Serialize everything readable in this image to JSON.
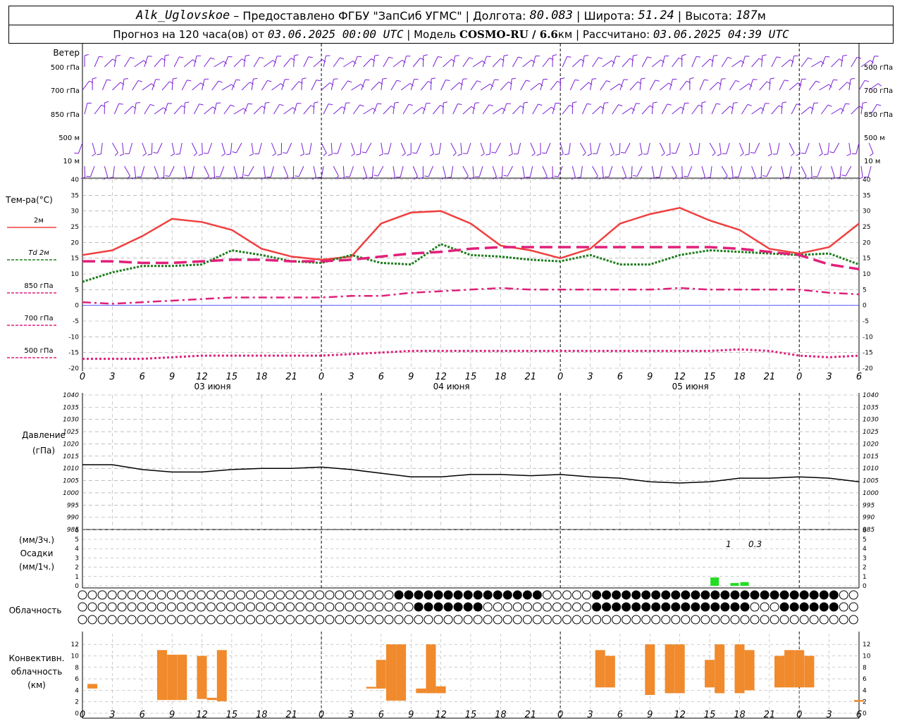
{
  "header": {
    "station": "Alk_Uglovskoe",
    "dash": " – ",
    "provider": "Предоставлено ФГБУ \"ЗапСиб УГМС\"",
    "sep": " | ",
    "lon_label": "Долгота: ",
    "lon_value": "80.083",
    "lat_label": "Широта: ",
    "lat_value": "51.24",
    "alt_label": "Высота: ",
    "alt_value": "187",
    "alt_unit": "м",
    "forecast_prefix": "Прогноз на 120 часа(ов) от ",
    "forecast_time": "03.06.2025 00:00 UTC",
    "model_label": "Модель ",
    "model_name": "COSMO-RU / 6.6",
    "model_unit": "км",
    "calc_label": "Рассчитано: ",
    "calc_time": "03.06.2025 04:39 UTC"
  },
  "colors": {
    "wind": "#7a1fd6",
    "t2m": "#f04040",
    "td2m": "#1e7d1e",
    "t850": "#e0207a",
    "t700": "#e0207a",
    "t500": "#e0207a",
    "zero_line": "#4040ff",
    "pressure": "#000000",
    "precip": "#22dd22",
    "convective": "#f08a2c",
    "grid": "#999999"
  },
  "wind_panel": {
    "title": "Ветер",
    "levels": [
      "500 гПа",
      "700 гПа",
      "850 гПа",
      "500 м",
      "10 м"
    ]
  },
  "temp_legend": {
    "title": "Тем-ра(°С)",
    "items": [
      "2м",
      "Td 2м",
      "850 гПа",
      "700 гПа",
      "500 гПа"
    ]
  },
  "pressure_label": [
    "Давление",
    "(гПа)"
  ],
  "precip_label": [
    "(мм/3ч.)",
    "Осадки",
    "(мм/1ч.)"
  ],
  "cloud_label": "Облачность",
  "conv_label": [
    "Конвективн.",
    "облачность",
    "(км)"
  ],
  "time_axis": {
    "tick_labels": [
      "0",
      "3",
      "6",
      "9",
      "12",
      "15",
      "18",
      "21",
      "0",
      "3",
      "6",
      "9",
      "12",
      "15",
      "18",
      "21",
      "0",
      "3",
      "6",
      "9",
      "12",
      "15",
      "18",
      "21",
      "0",
      "3",
      "6"
    ],
    "day_labels": [
      "03 июня",
      "04 июня",
      "05 июня"
    ]
  },
  "chart_data": [
    {
      "type": "line",
      "title": "Тем-ра(°С)",
      "xlabel": "UTC",
      "ylim": [
        -20,
        40
      ],
      "yticks": [
        40,
        35,
        30,
        25,
        20,
        15,
        10,
        5,
        0,
        -5,
        -10,
        -15,
        -20
      ],
      "x": [
        0,
        3,
        6,
        9,
        12,
        15,
        18,
        21,
        24,
        27,
        30,
        33,
        36,
        39,
        42,
        45,
        48,
        51,
        54,
        57,
        60,
        63,
        66,
        69,
        72,
        75,
        78
      ],
      "series": [
        {
          "name": "2м",
          "values": [
            16,
            17.5,
            22,
            27.5,
            26.5,
            24,
            18,
            15.5,
            14.5,
            15.5,
            26,
            29.5,
            30,
            26,
            19,
            17.5,
            15,
            18,
            26,
            29,
            31,
            27,
            24,
            18,
            16.5,
            18.5,
            26
          ]
        },
        {
          "name": "Td 2м",
          "values": [
            7.5,
            10.5,
            12.5,
            12.5,
            13,
            17.5,
            16,
            14,
            13.5,
            16,
            13.5,
            13,
            19.5,
            16,
            15.5,
            14.5,
            14,
            16,
            13,
            13,
            16,
            17.5,
            17,
            16.5,
            16,
            16.5,
            13
          ]
        },
        {
          "name": "850 гПа",
          "values": [
            14,
            14,
            13.5,
            13.5,
            14,
            14.5,
            14.5,
            14,
            14,
            14.5,
            15.5,
            16.5,
            17,
            18,
            18.5,
            18.5,
            18.5,
            18.5,
            18.5,
            18.5,
            18.5,
            18.5,
            18,
            17,
            16,
            13,
            11.5
          ]
        },
        {
          "name": "700 гПа",
          "values": [
            1,
            0.5,
            1,
            1.5,
            2,
            2.5,
            2.5,
            2.5,
            2.5,
            3,
            3,
            4,
            4.5,
            5,
            5.5,
            5,
            5,
            5,
            5,
            5,
            5.5,
            5,
            5,
            5,
            5,
            4,
            3.5
          ]
        },
        {
          "name": "500 гПа",
          "values": [
            -17,
            -17,
            -17,
            -16.5,
            -16,
            -16,
            -16,
            -16,
            -16,
            -15.5,
            -15,
            -14.5,
            -14.5,
            -14.5,
            -14.5,
            -14.5,
            -14.5,
            -14.5,
            -14.5,
            -14.5,
            -14.5,
            -14.5,
            -14,
            -14.5,
            -16,
            -16.5,
            -16
          ]
        }
      ]
    },
    {
      "type": "line",
      "title": "Давление",
      "ylabel": "(гПа)",
      "ylim": [
        985,
        1040
      ],
      "yticks": [
        1040,
        1035,
        1030,
        1025,
        1020,
        1015,
        1010,
        1005,
        1000,
        995,
        990,
        985
      ],
      "x": [
        0,
        3,
        6,
        9,
        12,
        15,
        18,
        21,
        24,
        27,
        30,
        33,
        36,
        39,
        42,
        45,
        48,
        51,
        54,
        57,
        60,
        63,
        66,
        69,
        72,
        75,
        78
      ],
      "series": [
        {
          "name": "Давление",
          "values": [
            1011.5,
            1011.5,
            1009.5,
            1008.5,
            1008.5,
            1009.5,
            1010,
            1010,
            1010.5,
            1009.5,
            1008,
            1006.5,
            1006.5,
            1007.5,
            1007.5,
            1007,
            1007.5,
            1006.5,
            1006,
            1004.5,
            1004,
            1004.5,
            1006,
            1006,
            1006.5,
            1006,
            1004.5
          ]
        }
      ]
    },
    {
      "type": "bar",
      "title": "Осадки",
      "ylim": [
        0,
        6
      ],
      "yticks": [
        6,
        5,
        4,
        3,
        2,
        1,
        0
      ],
      "x": [
        63.5,
        65.5,
        66.5
      ],
      "values": [
        0.9,
        0.3,
        0.4
      ],
      "annotations": [
        "1",
        "0.3"
      ]
    },
    {
      "type": "bar",
      "title": "Конвективн. облачность (км)",
      "ylim": [
        0,
        13
      ],
      "yticks": [
        12,
        10,
        8,
        6,
        4,
        2,
        0
      ],
      "bars": [
        {
          "x": 1,
          "bottom": 4.3,
          "top": 5.1
        },
        {
          "x": 8,
          "bottom": 2.3,
          "top": 11
        },
        {
          "x": 9,
          "bottom": 2.3,
          "top": 10.2
        },
        {
          "x": 10,
          "bottom": 2.3,
          "top": 10.2
        },
        {
          "x": 12,
          "bottom": 2.5,
          "top": 10
        },
        {
          "x": 13,
          "bottom": 2.3,
          "top": 2.7
        },
        {
          "x": 14,
          "bottom": 2.1,
          "top": 11
        },
        {
          "x": 29,
          "bottom": 4.3,
          "top": 4.6
        },
        {
          "x": 30,
          "bottom": 4.3,
          "top": 9.3
        },
        {
          "x": 31,
          "bottom": 2.2,
          "top": 12
        },
        {
          "x": 32,
          "bottom": 2.2,
          "top": 12
        },
        {
          "x": 34,
          "bottom": 3.5,
          "top": 4.3
        },
        {
          "x": 35,
          "bottom": 3.5,
          "top": 12
        },
        {
          "x": 36,
          "bottom": 3.5,
          "top": 4.7
        },
        {
          "x": 52,
          "bottom": 4.5,
          "top": 11
        },
        {
          "x": 53,
          "bottom": 4.5,
          "top": 10
        },
        {
          "x": 57,
          "bottom": 3.2,
          "top": 12
        },
        {
          "x": 59,
          "bottom": 3.5,
          "top": 12
        },
        {
          "x": 60,
          "bottom": 3.5,
          "top": 12
        },
        {
          "x": 63,
          "bottom": 4.5,
          "top": 9.3
        },
        {
          "x": 64,
          "bottom": 3.5,
          "top": 12
        },
        {
          "x": 66,
          "bottom": 3.5,
          "top": 12
        },
        {
          "x": 67,
          "bottom": 4.0,
          "top": 11
        },
        {
          "x": 70,
          "bottom": 4.5,
          "top": 10
        },
        {
          "x": 71,
          "bottom": 4.5,
          "top": 11
        },
        {
          "x": 72,
          "bottom": 4.5,
          "top": 11
        },
        {
          "x": 73,
          "bottom": 4.5,
          "top": 10
        },
        {
          "x": 78,
          "bottom": 2.0,
          "top": 2.3
        }
      ]
    }
  ]
}
